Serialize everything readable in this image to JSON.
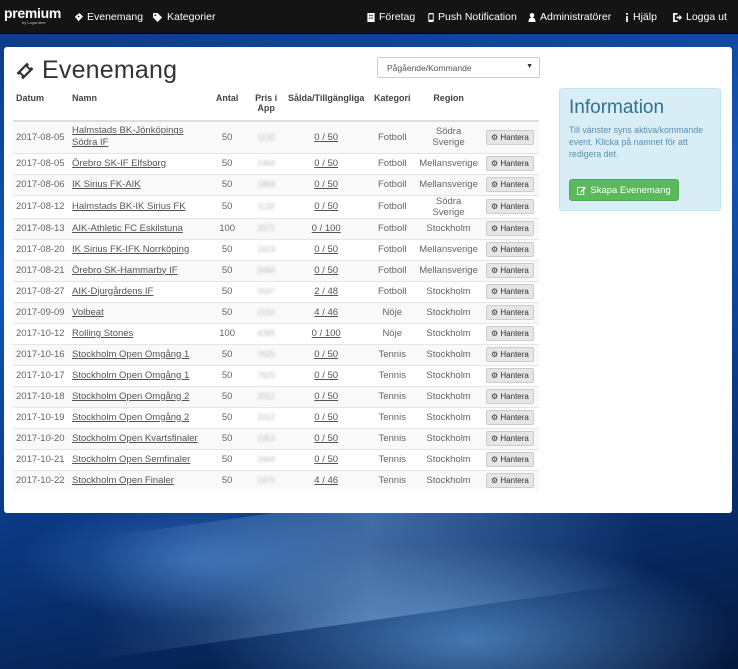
{
  "brand": {
    "name": "premium",
    "sub": "by Lagardère"
  },
  "nav": {
    "left": [
      {
        "label": "Evenemang",
        "icon": "ticket-icon"
      },
      {
        "label": "Kategorier",
        "icon": "tags-icon"
      }
    ],
    "right": [
      {
        "label": "Företag",
        "icon": "building-icon"
      },
      {
        "label": "Push Notification",
        "icon": "mobile-icon"
      },
      {
        "label": "Administratörer",
        "icon": "user-icon"
      },
      {
        "label": "Hjälp",
        "icon": "info-icon"
      },
      {
        "label": "Logga ut",
        "icon": "logout-icon"
      }
    ]
  },
  "page": {
    "title": "Evenemang",
    "filter": {
      "selected": "Pågående/Kommande"
    }
  },
  "table": {
    "headers": {
      "date": "Datum",
      "name": "Namn",
      "count": "Antal",
      "price": "Pris i App",
      "sold": "Sålda/Tillgängliga",
      "category": "Kategori",
      "region": "Region"
    },
    "action_label": "Hantera",
    "rows": [
      {
        "date": "2017-08-05",
        "name": "Halmstads BK-Jönköpings Södra IF",
        "count": "50",
        "price": "1132",
        "sold": "0 / 50",
        "category": "Fotboll",
        "region": "Södra Sverige"
      },
      {
        "date": "2017-08-05",
        "name": "Örebro SK-IF Elfsborg",
        "count": "50",
        "price": "2494",
        "sold": "0 / 50",
        "category": "Fotboll",
        "region": "Mellansverige"
      },
      {
        "date": "2017-08-06",
        "name": "IK Sirius FK-AIK",
        "count": "50",
        "price": "1869",
        "sold": "0 / 50",
        "category": "Fotboll",
        "region": "Mellansverige"
      },
      {
        "date": "2017-08-12",
        "name": "Halmstads BK-IK Sirius FK",
        "count": "50",
        "price": "1132",
        "sold": "0 / 50",
        "category": "Fotboll",
        "region": "Södra Sverige"
      },
      {
        "date": "2017-08-13",
        "name": "AIK-Athletic FC Eskilstuna",
        "count": "100",
        "price": "2072",
        "sold": "0 / 100",
        "category": "Fotboll",
        "region": "Stockholm"
      },
      {
        "date": "2017-08-20",
        "name": "IK Sirius FK-IFK Norrköping",
        "count": "50",
        "price": "1619",
        "sold": "0 / 50",
        "category": "Fotboll",
        "region": "Mellansverige"
      },
      {
        "date": "2017-08-21",
        "name": "Örebro SK-Hammarby IF",
        "count": "50",
        "price": "2494",
        "sold": "0 / 50",
        "category": "Fotboll",
        "region": "Mellansverige"
      },
      {
        "date": "2017-08-27",
        "name": "AIK-Djurgårdens IF",
        "count": "50",
        "price": "3547",
        "sold": "2 / 48",
        "category": "Fotboll",
        "region": "Stockholm"
      },
      {
        "date": "2017-09-09",
        "name": "Volbeat",
        "count": "50",
        "price": "2150",
        "sold": "4 / 46",
        "category": "Nöje",
        "region": "Stockholm"
      },
      {
        "date": "2017-10-12",
        "name": "Rolling Stones",
        "count": "100",
        "price": "4395",
        "sold": "0 / 100",
        "category": "Nöje",
        "region": "Stockholm"
      },
      {
        "date": "2017-10-16",
        "name": "Stockholm Open Omgång 1",
        "count": "50",
        "price": "7625",
        "sold": "0 / 50",
        "category": "Tennis",
        "region": "Stockholm"
      },
      {
        "date": "2017-10-17",
        "name": "Stockholm Open Omgång 1",
        "count": "50",
        "price": "7625",
        "sold": "0 / 50",
        "category": "Tennis",
        "region": "Stockholm"
      },
      {
        "date": "2017-10-18",
        "name": "Stockholm Open Omgång 2",
        "count": "50",
        "price": "2012",
        "sold": "0 / 50",
        "category": "Tennis",
        "region": "Stockholm"
      },
      {
        "date": "2017-10-19",
        "name": "Stockholm Open Omgång 2",
        "count": "50",
        "price": "2012",
        "sold": "0 / 50",
        "category": "Tennis",
        "region": "Stockholm"
      },
      {
        "date": "2017-10-20",
        "name": "Stockholm Open Kvartsfinaler",
        "count": "50",
        "price": "2353",
        "sold": "0 / 50",
        "category": "Tennis",
        "region": "Stockholm"
      },
      {
        "date": "2017-10-21",
        "name": "Stockholm Open Semfinaler",
        "count": "50",
        "price": "3444",
        "sold": "0 / 50",
        "category": "Tennis",
        "region": "Stockholm"
      },
      {
        "date": "2017-10-22",
        "name": "Stockholm Open Finaler",
        "count": "50",
        "price": "1970",
        "sold": "4 / 46",
        "category": "Tennis",
        "region": "Stockholm"
      }
    ]
  },
  "info": {
    "title": "Information",
    "text": "Till vänster syns aktiva/kommande event. Klicka på namnet för att redigera det.",
    "button": "Skapa Evenemang"
  },
  "colors": {
    "navbar": "#141414",
    "info_bg": "#d9edf7",
    "info_title": "#31708f",
    "create_button": "#5cb85c"
  }
}
